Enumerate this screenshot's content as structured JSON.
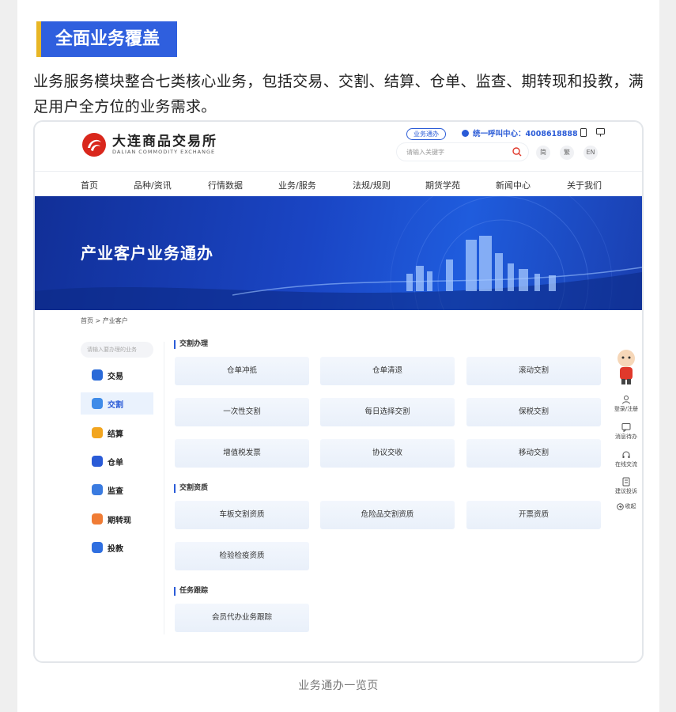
{
  "heading": "全面业务覆盖",
  "intro": "业务服务模块整合七类核心业务，包括交易、交割、结算、仓单、监查、期转现和投教，满足用户全方位的业务需求。",
  "screenshot": {
    "logo_cn": "大连商品交易所",
    "logo_en": "DALIAN COMMODITY EXCHANGE",
    "pill": "业务通办",
    "hotline": "统一呼叫中心：4008618888",
    "search_placeholder": "请输入关键字",
    "lang": [
      "简",
      "繁",
      "EN"
    ],
    "nav": [
      "首页",
      "品种/资讯",
      "行情数据",
      "业务/服务",
      "法规/规则",
      "期货学苑",
      "新闻中心",
      "关于我们"
    ],
    "banner_title": "产业客户业务通办",
    "breadcrumb": "首页 > 产业客户",
    "side_search_placeholder": "请输入要办理的业务",
    "side_items": [
      {
        "label": "交易",
        "color": "#2a6ad8"
      },
      {
        "label": "交割",
        "color": "#3f8be8"
      },
      {
        "label": "结算",
        "color": "#f2a51f"
      },
      {
        "label": "仓单",
        "color": "#2a5bd7"
      },
      {
        "label": "监查",
        "color": "#3a7be0"
      },
      {
        "label": "期转现",
        "color": "#f07c35"
      },
      {
        "label": "投教",
        "color": "#2f6fe0"
      }
    ],
    "sections": [
      {
        "title": "交割办理",
        "cards": [
          "仓单冲抵",
          "仓单清退",
          "滚动交割",
          "一次性交割",
          "每日选择交割",
          "保税交割",
          "增值税发票",
          "协议交收",
          "移动交割"
        ]
      },
      {
        "title": "交割资质",
        "cards": [
          "车板交割资质",
          "危险品交割资质",
          "开票资质",
          "检验检疫资质"
        ]
      },
      {
        "title": "任务跟踪",
        "cards": [
          "会员代办业务跟踪"
        ]
      }
    ],
    "float_items": [
      "登录/注册",
      "消息待办",
      "在线交流",
      "建议投诉",
      "收起"
    ]
  },
  "caption": "业务通办一览页",
  "colors": {
    "accent": "#2f5fde",
    "heading_bar": "#e8b625",
    "banner": "#1a45c4"
  }
}
